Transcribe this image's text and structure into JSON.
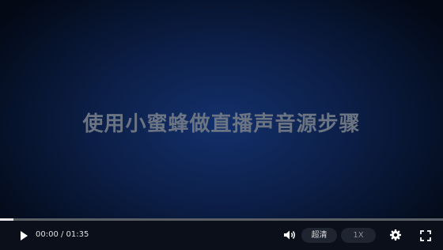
{
  "video": {
    "title": "使用小蜜蜂做直播声音源步骤"
  },
  "controls": {
    "time_display": "00:00 / 01:35",
    "quality_label": "超清",
    "speed_label": "1X",
    "progress_fraction": 0.03
  },
  "icons": {
    "play": "play-icon",
    "volume": "volume-icon",
    "settings": "gear-icon",
    "fullscreen": "fullscreen-icon"
  },
  "colors": {
    "background_center": "#13306b",
    "background_edge": "#030915",
    "title_text": "#6b7482"
  }
}
